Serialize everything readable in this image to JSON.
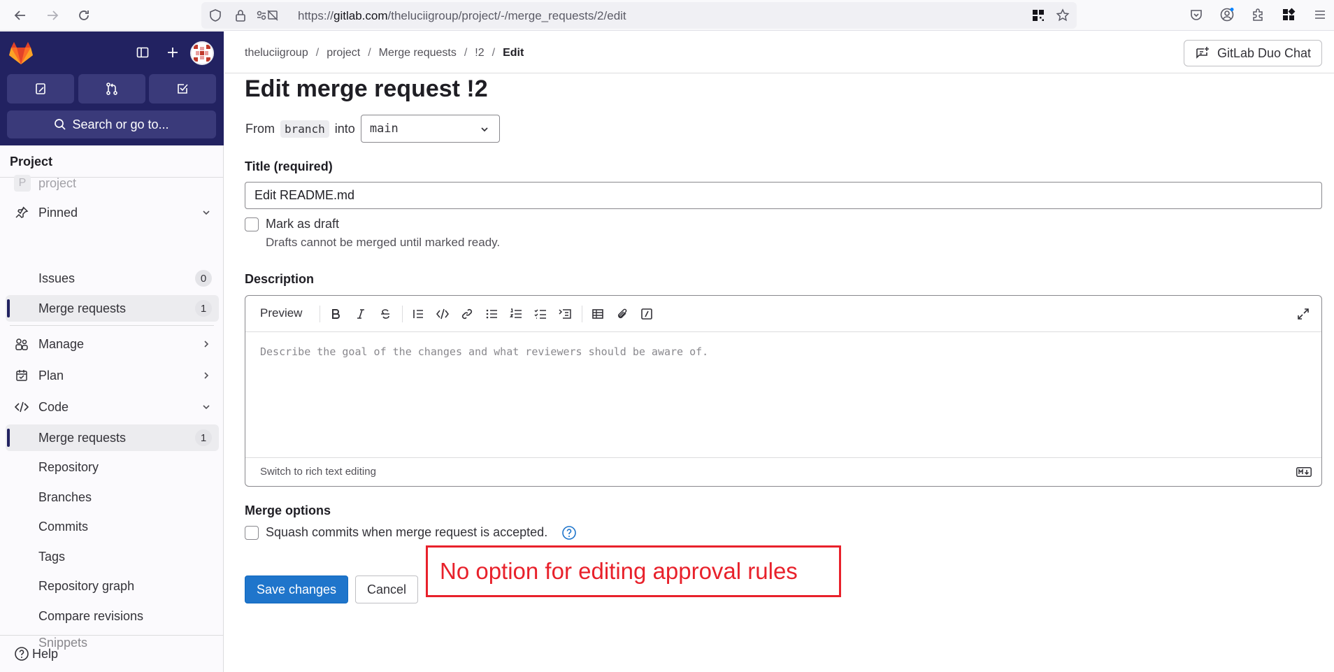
{
  "browser": {
    "url_prefix": "https://",
    "url_host": "gitlab.com",
    "url_path": "/theluciigroup/project/-/merge_requests/2/edit"
  },
  "sidebar": {
    "search_label": "Search or go to...",
    "section_title": "Project",
    "project_name": "project",
    "project_initial": "P",
    "pinned": {
      "label": "Pinned",
      "items": [
        {
          "label": "Issues",
          "count": "0"
        },
        {
          "label": "Merge requests",
          "count": "1"
        }
      ]
    },
    "manage_label": "Manage",
    "plan_label": "Plan",
    "code": {
      "label": "Code",
      "items": [
        {
          "label": "Merge requests",
          "count": "1"
        },
        {
          "label": "Repository"
        },
        {
          "label": "Branches"
        },
        {
          "label": "Commits"
        },
        {
          "label": "Tags"
        },
        {
          "label": "Repository graph"
        },
        {
          "label": "Compare revisions"
        },
        {
          "label": "Snippets"
        }
      ]
    },
    "help_label": "Help"
  },
  "breadcrumb": [
    "theluciigroup",
    "project",
    "Merge requests",
    "!2",
    "Edit"
  ],
  "duo_chat_label": "GitLab Duo Chat",
  "page": {
    "title": "Edit merge request !2",
    "from_label": "From",
    "source_branch": "branch",
    "into_label": "into",
    "target_branch": "main",
    "title_label": "Title (required)",
    "title_value": "Edit README.md",
    "draft_label": "Mark as draft",
    "draft_help": "Drafts cannot be merged until marked ready.",
    "description_label": "Description",
    "preview_label": "Preview",
    "description_placeholder": "Describe the goal of the changes and what reviewers should be aware of.",
    "switch_label": "Switch to rich text editing",
    "merge_options_label": "Merge options",
    "squash_label": "Squash commits when merge request is accepted.",
    "save_label": "Save changes",
    "cancel_label": "Cancel"
  },
  "annotation": {
    "text": "No option for editing approval rules",
    "color": "#e8212b"
  },
  "colors": {
    "sidebar_dark": "#222261",
    "primary": "#1f75cb"
  }
}
